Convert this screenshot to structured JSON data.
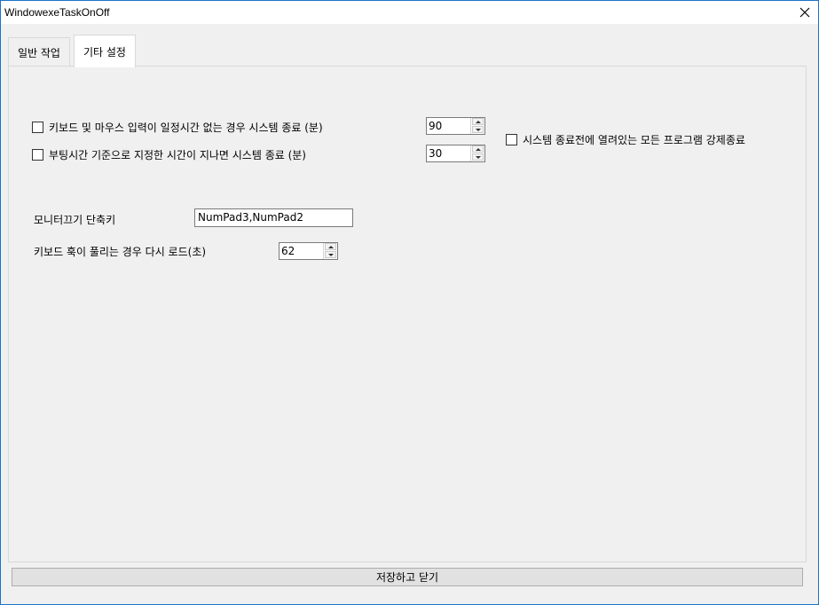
{
  "window": {
    "title": "WindowexeTaskOnOff"
  },
  "tabs": [
    {
      "label": "일반 작업",
      "active": false
    },
    {
      "label": "기타 설정",
      "active": true
    }
  ],
  "settings": {
    "idle_shutdown": {
      "label": "키보드 및 마우스 입력이 일정시간 없는 경우 시스템 종료 (분)",
      "checked": false,
      "value": "90"
    },
    "boot_shutdown": {
      "label": "부팅시간 기준으로 지정한 시간이 지나면 시스템 종료 (분)",
      "checked": false,
      "value": "30"
    },
    "force_close": {
      "label": "시스템 종료전에 열려있는 모든 프로그램 강제종료",
      "checked": false
    },
    "monitor_hotkey": {
      "label": "모니터끄기 단축키",
      "value": "NumPad3,NumPad2"
    },
    "keyboard_reload": {
      "label": "키보드 훅이 풀리는 경우 다시 로드(초)",
      "value": "62"
    }
  },
  "footer": {
    "save_label": "저장하고 닫기"
  }
}
